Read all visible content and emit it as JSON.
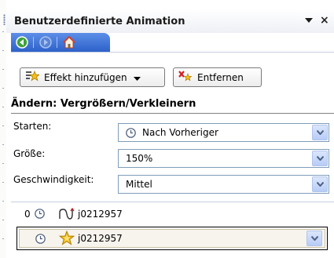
{
  "panel": {
    "title": "Benutzerdefinierte Animation",
    "close_glyph": "×"
  },
  "nav": {
    "back_icon": "back-arrow-icon",
    "forward_icon": "forward-arrow-icon",
    "home_icon": "home-icon"
  },
  "toolbar": {
    "add_effect_label": "Effekt hinzufügen",
    "remove_label": "Entfernen"
  },
  "modify": {
    "heading": "Ändern: Vergrößern/Verkleinern",
    "start_label": "Starten:",
    "start_value": "Nach Vorheriger",
    "size_label": "Größe:",
    "size_value": "150%",
    "speed_label": "Geschwindigkeit:",
    "speed_value": "Mittel"
  },
  "effects_list": {
    "items": [
      {
        "index": "0",
        "name": "j0212957",
        "icon": "motion-path-icon"
      },
      {
        "index": "",
        "name": "j0212957",
        "icon": "emphasis-star-icon",
        "selected": true
      }
    ]
  },
  "colors": {
    "nav_bar": "#3a6fd6",
    "combo_border": "#7f9db9",
    "dropdown_button": "#c4d5f8"
  }
}
